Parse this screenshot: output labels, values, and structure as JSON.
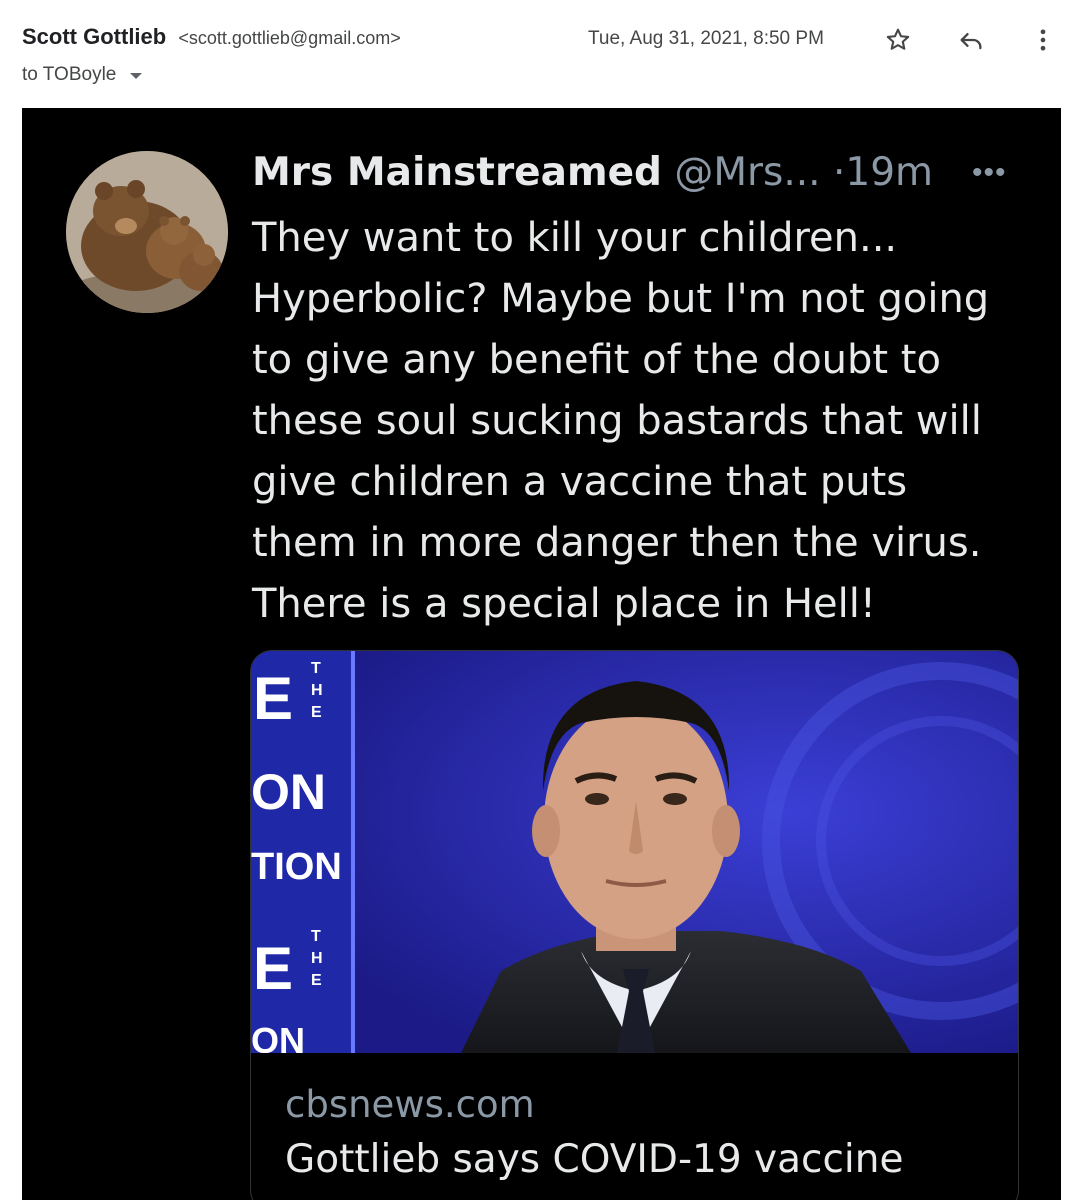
{
  "email": {
    "sender_name": "Scott Gottlieb",
    "sender_email": "<scott.gottlieb@gmail.com>",
    "recipient": "to TOBoyle",
    "date": "Tue, Aug 31, 2021, 8:50 PM",
    "icons": [
      "star-icon",
      "reply-icon",
      "more-vert-icon",
      "chevron-down-icon"
    ]
  },
  "tweet": {
    "author_name": "Mrs Mainstreamed",
    "handle": "@Mrs...",
    "dot": "·",
    "age": "19m",
    "more": "•••",
    "text_lines": [
      "They want to kill your children...",
      "Hyperbolic? Maybe but I'm not going",
      "to give any benefit of the doubt to",
      "these soul sucking bastards that will",
      "give children a vaccine that puts",
      "them in more danger then the virus.",
      "There is a special place in Hell!"
    ],
    "link_card": {
      "domain": "cbsnews.com",
      "title": "Gottlieb says COVID-19 vaccine",
      "image_sign_letters": [
        "E",
        "T",
        "H",
        "E",
        "ON",
        "TION",
        "E",
        "T",
        "H",
        "E",
        "ON"
      ]
    }
  },
  "colors": {
    "tweet_bg": "#000000",
    "tweet_text": "#e7e9ea",
    "tweet_muted": "#8b98a5",
    "studio_blue": "#2322a3"
  }
}
